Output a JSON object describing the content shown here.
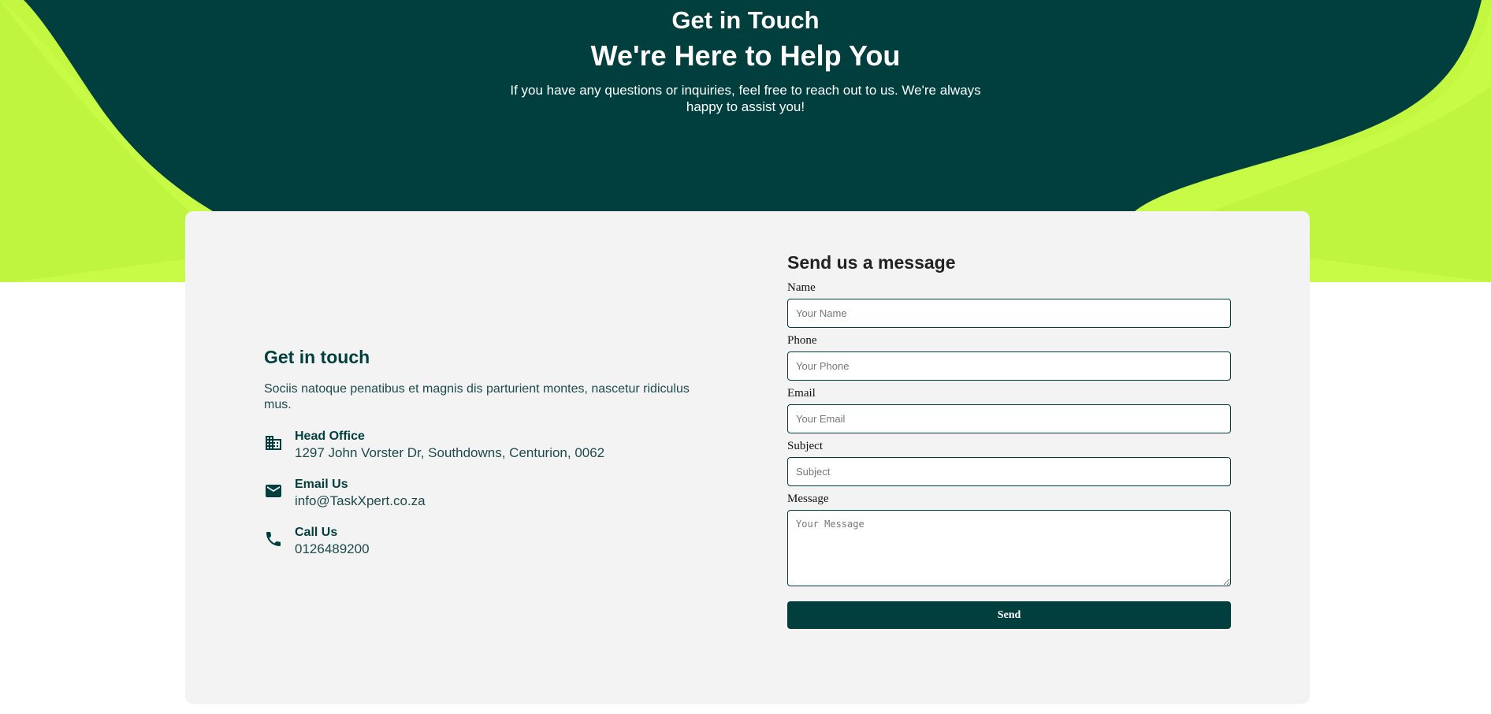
{
  "hero": {
    "kicker": "Get in Touch",
    "title": "We're Here to Help You",
    "subtitle": "If you have any questions or inquiries, feel free to reach out to us. We're always happy to assist you!"
  },
  "info": {
    "title": "Get in touch",
    "description": "Sociis natoque penatibus et magnis dis parturient montes, nascetur ridiculus mus.",
    "items": [
      {
        "icon": "building-icon",
        "label": "Head Office",
        "value": "1297 John Vorster Dr, Southdowns, Centurion, 0062"
      },
      {
        "icon": "mail-icon",
        "label": "Email Us",
        "value": "info@TaskXpert.co.za"
      },
      {
        "icon": "phone-icon",
        "label": "Call Us",
        "value": "0126489200"
      }
    ]
  },
  "form": {
    "title": "Send us a message",
    "name": {
      "label": "Name",
      "placeholder": "Your Name",
      "value": ""
    },
    "phone": {
      "label": "Phone",
      "placeholder": "Your Phone",
      "value": ""
    },
    "email": {
      "label": "Email",
      "placeholder": "Your Email",
      "value": ""
    },
    "subject": {
      "label": "Subject",
      "placeholder": "Subject",
      "value": ""
    },
    "message": {
      "label": "Message",
      "placeholder": "Your Message",
      "value": ""
    },
    "send_label": "Send"
  },
  "colors": {
    "primary": "#013f3f",
    "accent": "#c7fb46",
    "card": "#f3f3f3"
  }
}
